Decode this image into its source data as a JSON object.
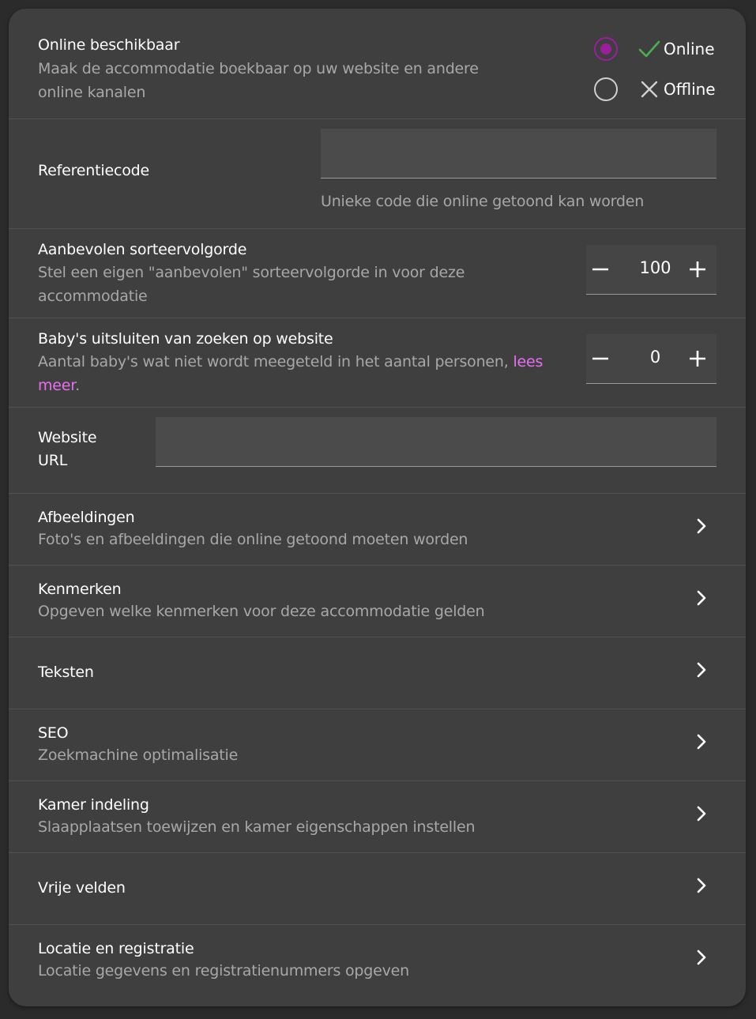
{
  "availability": {
    "title": "Online beschikbaar",
    "description_line1": "Maak de accommodatie boekbaar op uw website en andere",
    "description_line2": "online kanalen",
    "options": [
      {
        "label": "Online",
        "icon": "check-icon",
        "selected": true
      },
      {
        "label": "Offline",
        "icon": "x-icon",
        "selected": false
      }
    ]
  },
  "reference": {
    "label": "Referentiecode",
    "value": "",
    "hint": "Unieke code die online getoond kan worden"
  },
  "sort_order": {
    "title": "Aanbevolen sorteervolgorde",
    "description_line1": "Stel een eigen \"aanbevolen\" sorteervolgorde in voor deze",
    "description_line2": "accommodatie",
    "value": "100"
  },
  "babies": {
    "title": "Baby's uitsluiten van zoeken op website",
    "description_line1": "Aantal baby's wat niet wordt meegeteld in het aantal personen,",
    "link_part1": "lees",
    "link_part2": "meer",
    "suffix": ".",
    "value": "0"
  },
  "website": {
    "label_line1": "Website",
    "label_line2": "URL",
    "value": ""
  },
  "nav_items": [
    {
      "title": "Afbeeldingen",
      "subtitle": "Foto's en afbeeldingen die online getoond moeten worden"
    },
    {
      "title": "Kenmerken",
      "subtitle": "Opgeven welke kenmerken voor deze accommodatie gelden"
    },
    {
      "title": "Teksten",
      "subtitle": ""
    },
    {
      "title": "SEO",
      "subtitle": "Zoekmachine optimalisatie"
    },
    {
      "title": "Kamer indeling",
      "subtitle": "Slaapplaatsen toewijzen en kamer eigenschappen instellen"
    },
    {
      "title": "Vrije velden",
      "subtitle": ""
    },
    {
      "title": "Locatie en registratie",
      "subtitle": "Locatie gegevens en registratienummers opgeven"
    }
  ],
  "colors": {
    "accent": "#9b1f9d",
    "link": "#e86ff0",
    "check": "#4caf50",
    "panel": "#3f3f3f"
  }
}
